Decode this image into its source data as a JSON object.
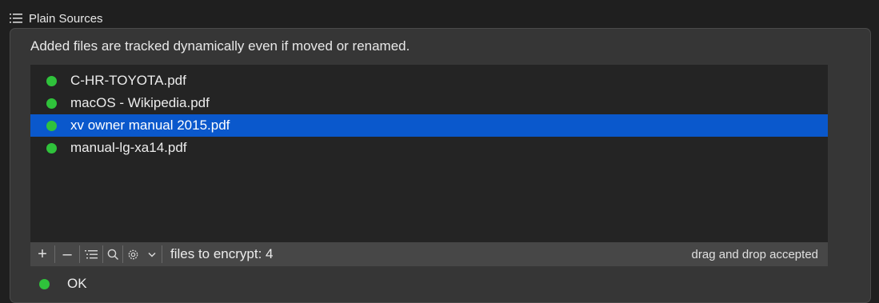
{
  "section": {
    "title": "Plain Sources",
    "icon": "list-icon"
  },
  "description": "Added files are tracked dynamically  even if moved or renamed.",
  "files": [
    {
      "name": "C-HR-TOYOTA.pdf",
      "status": "ok",
      "selected": false
    },
    {
      "name": "macOS - Wikipedia.pdf",
      "status": "ok",
      "selected": false
    },
    {
      "name": "xv owner manual 2015.pdf",
      "status": "ok",
      "selected": true
    },
    {
      "name": "manual-lg-xa14.pdf",
      "status": "ok",
      "selected": false
    }
  ],
  "toolbar": {
    "add_label": "+",
    "remove_label": "–",
    "files_count": "files to encrypt: 4",
    "drag_drop": "drag and drop accepted"
  },
  "status": {
    "text": "OK"
  },
  "colors": {
    "status_ok": "#2fc23b",
    "selection": "#0a58cc"
  }
}
